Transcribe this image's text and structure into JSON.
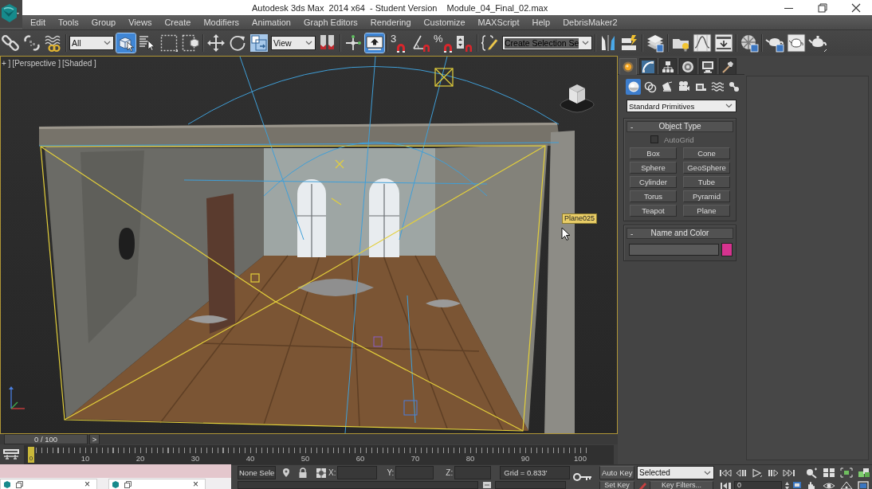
{
  "window": {
    "title": "Autodesk 3ds Max  2014 x64  - Student Version    Module_04_Final_02.max"
  },
  "menu": [
    "Edit",
    "Tools",
    "Group",
    "Views",
    "Create",
    "Modifiers",
    "Animation",
    "Graph Editors",
    "Rendering",
    "Customize",
    "MAXScript",
    "Help",
    "DebrisMaker2"
  ],
  "toolbar": [
    {
      "kind": "button",
      "active": false
    },
    {
      "kind": "button",
      "active": false
    },
    {
      "kind": "button",
      "active": false
    },
    {
      "kind": "separator"
    },
    {
      "kind": "dropdown",
      "value": "All",
      "highlighted": false
    },
    {
      "kind": "button",
      "active": true
    },
    {
      "kind": "button",
      "active": false
    },
    {
      "kind": "button",
      "active": false
    },
    {
      "kind": "button",
      "active": false
    },
    {
      "kind": "separator"
    },
    {
      "kind": "button",
      "active": false
    },
    {
      "kind": "button",
      "active": false
    },
    {
      "kind": "button",
      "active": false
    },
    {
      "kind": "dropdown",
      "value": "View",
      "highlighted": false
    },
    {
      "kind": "button",
      "active": false
    },
    {
      "kind": "separator"
    },
    {
      "kind": "button",
      "active": false
    },
    {
      "kind": "button",
      "active": true
    },
    {
      "kind": "separator"
    },
    {
      "kind": "button",
      "label": "3",
      "active": false
    },
    {
      "kind": "button",
      "active": false
    },
    {
      "kind": "button",
      "label": "%",
      "active": false
    },
    {
      "kind": "button",
      "active": false
    },
    {
      "kind": "separator"
    },
    {
      "kind": "button",
      "active": false
    },
    {
      "kind": "dropdown",
      "value": "Create Selection Se",
      "highlighted": true
    },
    {
      "kind": "separator"
    },
    {
      "kind": "button",
      "active": false
    },
    {
      "kind": "button",
      "active": false
    },
    {
      "kind": "separator"
    },
    {
      "kind": "button",
      "active": false
    },
    {
      "kind": "separator"
    },
    {
      "kind": "button",
      "active": false
    },
    {
      "kind": "button",
      "active": false
    },
    {
      "kind": "button",
      "active": false
    },
    {
      "kind": "separator"
    },
    {
      "kind": "button",
      "active": false
    },
    {
      "kind": "separator"
    },
    {
      "kind": "button",
      "active": false
    },
    {
      "kind": "button",
      "active": false
    },
    {
      "kind": "button",
      "active": false
    }
  ],
  "viewport": {
    "labels": [
      "+ ]",
      "[Perspective ]",
      "[Shaded ]"
    ],
    "tooltip": "Plane025"
  },
  "command_panel": {
    "tabs": [
      {
        "selected": true
      },
      {
        "selected": false
      },
      {
        "selected": false
      },
      {
        "selected": false
      },
      {
        "selected": false
      },
      {
        "selected": false
      }
    ],
    "object_categories": [
      {
        "selected": true
      },
      {
        "selected": false
      },
      {
        "selected": false
      },
      {
        "selected": false
      },
      {
        "selected": false
      },
      {
        "selected": false
      },
      {
        "selected": false
      }
    ],
    "object_class": "Standard Primitives",
    "object_type": {
      "title": "Object Type",
      "collapse": "-",
      "autogrid": {
        "label": "AutoGrid",
        "checked": false
      },
      "buttons": [
        "Box",
        "Cone",
        "Sphere",
        "GeoSphere",
        "Cylinder",
        "Tube",
        "Torus",
        "Pyramid",
        "Teapot",
        "Plane"
      ]
    },
    "name_and_color": {
      "title": "Name and Color",
      "collapse": "-",
      "color": "#d6338f"
    }
  },
  "time_slider": {
    "position": "0 / 100",
    "next": ">"
  },
  "track_bar": {
    "current_frame": "0",
    "labels": [
      "10",
      "20",
      "30",
      "40",
      "50",
      "60",
      "70",
      "80",
      "90",
      "100"
    ]
  },
  "taskbar_previews": [
    {
      "close": "×"
    },
    {
      "close": "×"
    }
  ],
  "status_bar": {
    "selection": "None Sele",
    "coords": [
      "X:",
      "Y:",
      "Z:"
    ],
    "grid": "Grid = 0.833'",
    "auto_key": "Auto Key",
    "key_mode": "Selected",
    "set_key": "Set Key",
    "key_filters": "Key Filters...",
    "frame": "0"
  }
}
